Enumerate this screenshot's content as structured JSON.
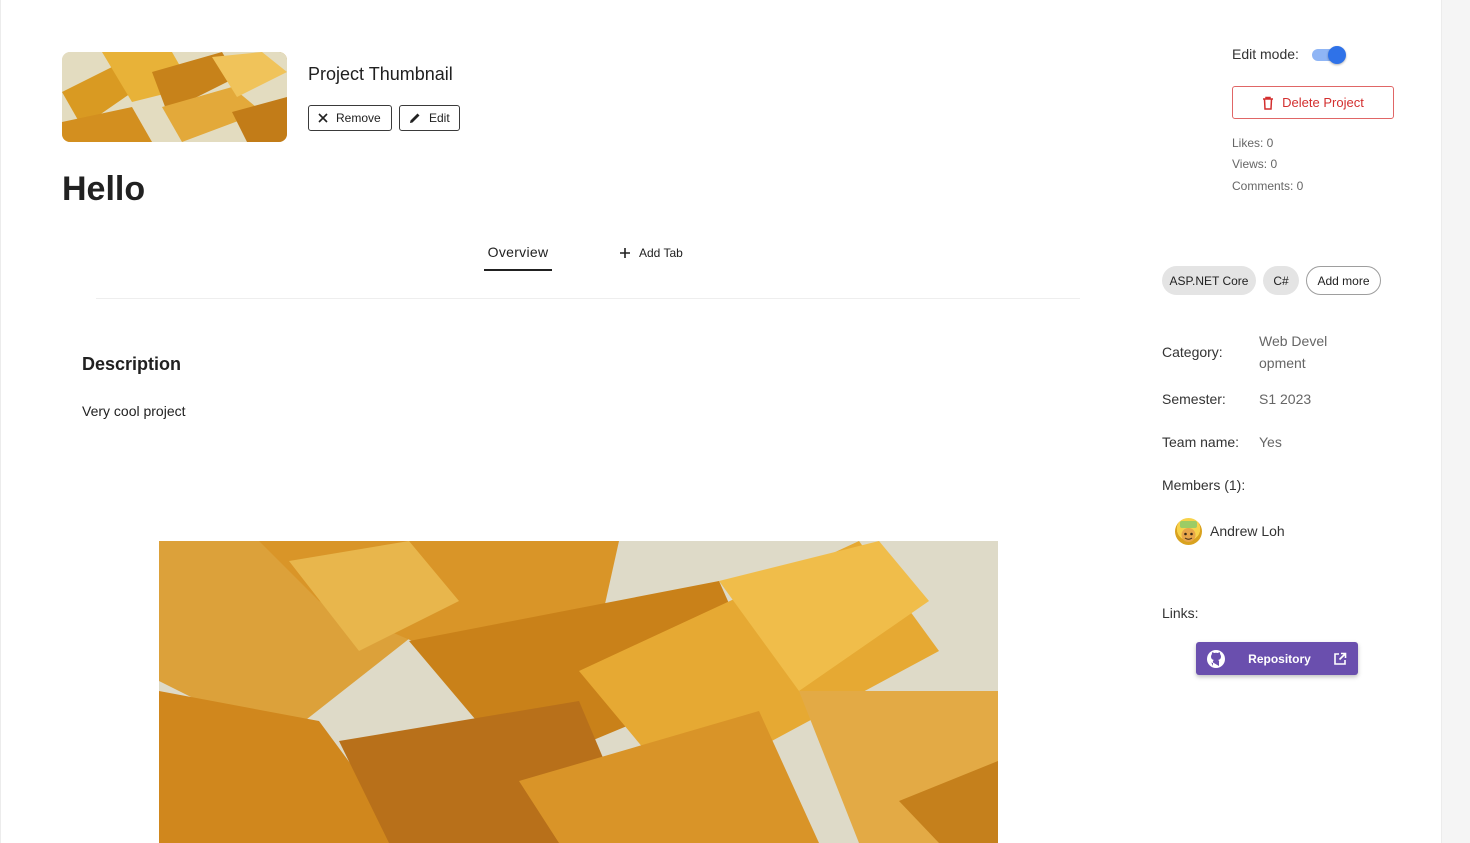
{
  "thumbnail": {
    "title": "Project Thumbnail",
    "remove_label": "Remove",
    "edit_label": "Edit"
  },
  "project": {
    "title": "Hello"
  },
  "tabs": [
    {
      "label": "Overview",
      "active": true
    },
    {
      "label": "Add Tab",
      "icon": "plus-icon"
    }
  ],
  "description": {
    "heading": "Description",
    "text": "Very cool project"
  },
  "sidebar": {
    "edit_mode_label": "Edit mode:",
    "edit_mode_on": true,
    "delete_label": "Delete Project",
    "stats": {
      "likes": "Likes: 0",
      "views": "Views: 0",
      "comments": "Comments: 0"
    },
    "tags": [
      "ASP.NET Core",
      "C#"
    ],
    "add_more_label": "Add more",
    "category_label": "Category:",
    "category_value_line1": "Web Devel",
    "category_value_line2": "opment",
    "semester_label": "Semester:",
    "semester_value": "S1 2023",
    "team_label": "Team name:",
    "team_value": "Yes",
    "members_label": "Members (1):",
    "members": [
      {
        "name": "Andrew Loh"
      }
    ],
    "links_label": "Links:",
    "repo_label": "Repository"
  },
  "colors": {
    "accent_toggle": "#2f72e8",
    "danger": "#d32f2f",
    "repo_button": "#6a4fae"
  }
}
